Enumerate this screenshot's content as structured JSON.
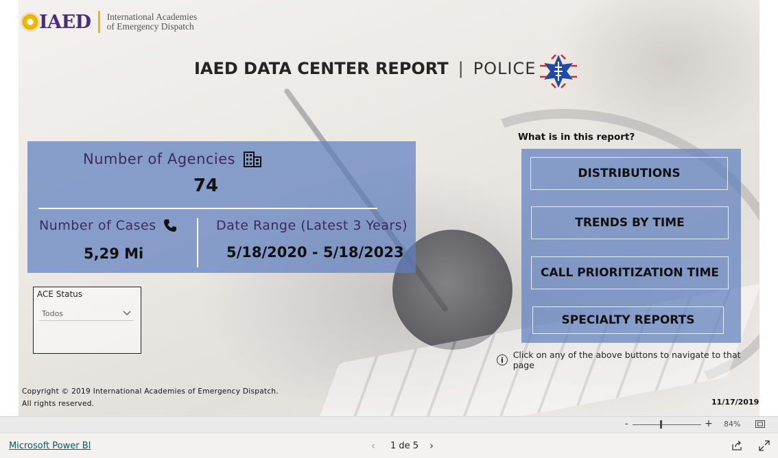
{
  "brand": {
    "logo_word": "IAED",
    "logo_sub_line1": "International Academies",
    "logo_sub_line2": "of Emergency Dispatch",
    "logo_color": "#4c2c7a",
    "accent_color": "#f1b800"
  },
  "report": {
    "title_bold": "IAED DATA CENTER REPORT",
    "separator": "|",
    "discipline": "POLICE"
  },
  "stats": {
    "agencies_label": "Number of Agencies",
    "agencies_value": "74",
    "cases_label": "Number of Cases",
    "cases_value": "5,29 Mi",
    "range_label": "Date Range (Latest 3 Years)",
    "range_value": "5/18/2020 - 5/18/2023",
    "panel_color": "#6080be"
  },
  "filter": {
    "title": "ACE Status",
    "selected": "Todos"
  },
  "menu": {
    "title": "What is in this report?",
    "buttons": [
      {
        "label": "DISTRIBUTIONS"
      },
      {
        "label": "TRENDS BY TIME"
      },
      {
        "label": "CALL PRIORITIZATION TIME"
      },
      {
        "label": "SPECIALTY REPORTS"
      }
    ],
    "info_text": "Click on any of the above buttons to navigate to that page"
  },
  "footer_text": {
    "copyright_line1": "Copyright © 2019 International Academies of Emergency Dispatch.",
    "copyright_line2": "All rights reserved.",
    "date": "11/17/2019"
  },
  "zoom": {
    "minus": "-",
    "plus": "+",
    "percent": "84%",
    "level": 0.84
  },
  "bottom_bar": {
    "link": "Microsoft Power BI",
    "prev": "‹",
    "page_indicator": "1 de 5",
    "next": "›"
  },
  "icons": [
    "building-icon",
    "phone-icon",
    "chevron-down-icon",
    "info-icon",
    "fit-to-page-icon",
    "share-icon",
    "expand-icon",
    "star-of-life-emblem"
  ]
}
